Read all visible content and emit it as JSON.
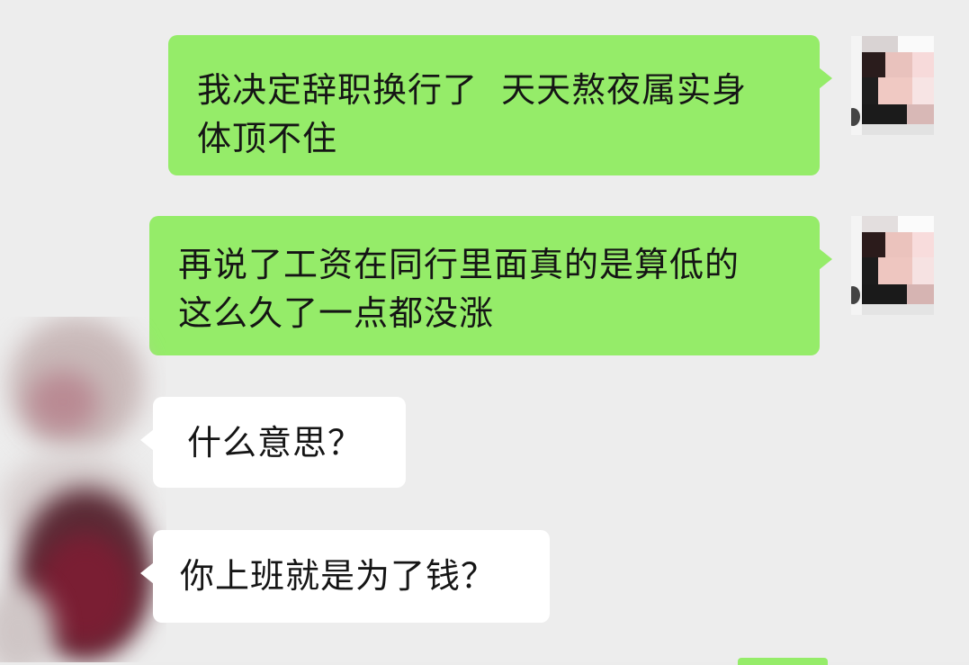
{
  "messages": [
    {
      "side": "outgoing",
      "text": "我决定辞职换行了  天天熬夜属实身\n体顶不住"
    },
    {
      "side": "outgoing",
      "text": "再说了工资在同行里面真的是算低的\n这么久了一点都没涨"
    },
    {
      "side": "incoming",
      "text": "什么意思？"
    },
    {
      "side": "incoming",
      "text": "你上班就是为了钱？"
    }
  ],
  "colors": {
    "background": "#ededed",
    "outgoing_bubble": "#95ec69",
    "incoming_bubble": "#ffffff",
    "text": "#151515"
  },
  "icons": {
    "self_avatar": "pixelated-avatar",
    "contact_avatar": "blurred-avatar"
  }
}
